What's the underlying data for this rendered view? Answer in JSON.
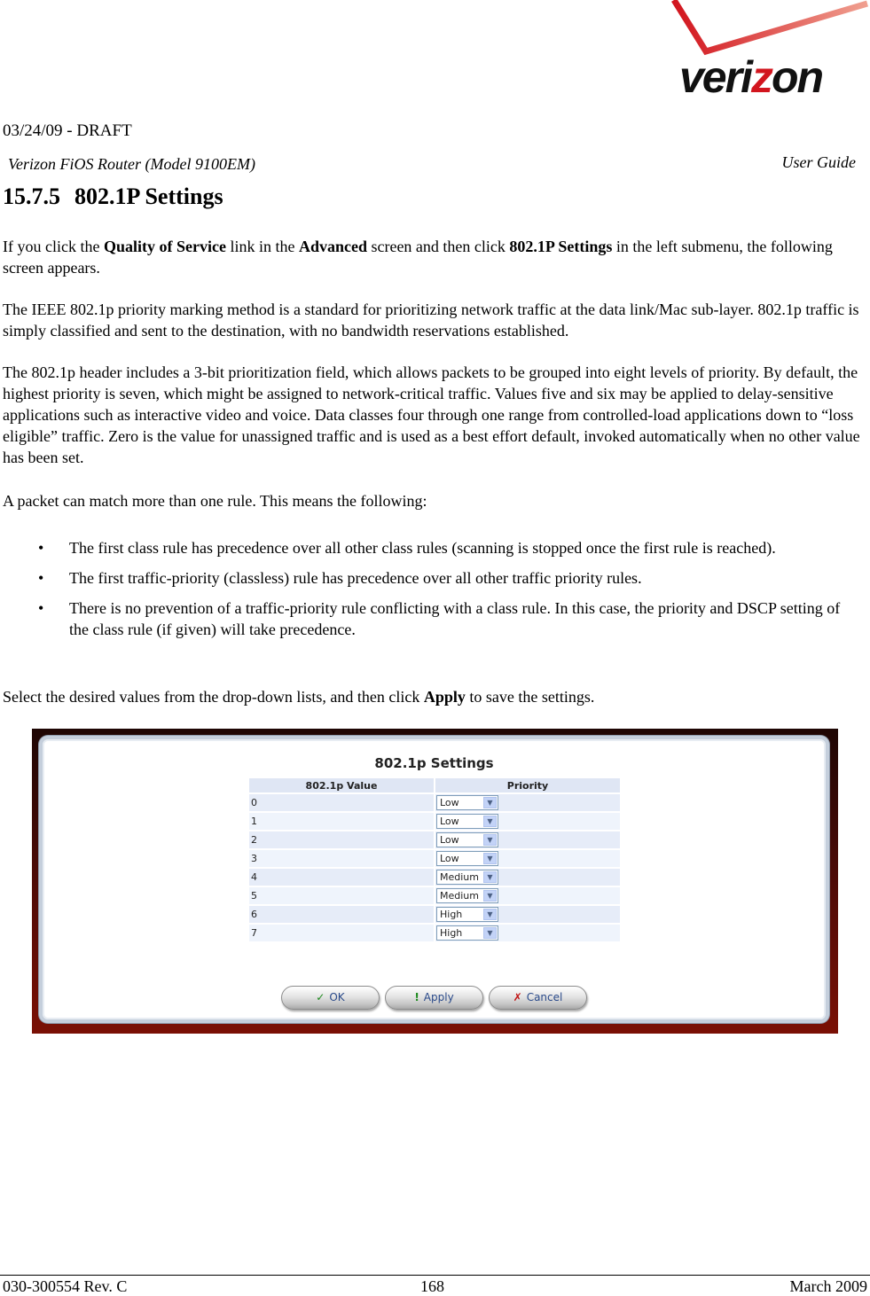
{
  "header": {
    "logo_text_pre": "veri",
    "logo_text_z": "z",
    "logo_text_post": "on",
    "draft": "03/24/09 - DRAFT",
    "model": "Verizon FiOS Router (Model 9100EM)",
    "guide": "User Guide"
  },
  "section": {
    "number": "15.7.5",
    "title": "802.1P Settings"
  },
  "body": {
    "p1": {
      "t1": "If you click the ",
      "b1": "Quality of Service",
      "t2": " link in the ",
      "b2": "Advanced",
      "t3": " screen and then click ",
      "b3": "802.1P Settings",
      "t4": " in the left submenu, the following screen appears."
    },
    "p2": "The IEEE 802.1p priority marking method is a standard for prioritizing network traffic at the data link/Mac sub-layer. 802.1p traffic is simply classified and sent to the destination, with no bandwidth reservations established.",
    "p3": "The 802.1p header includes a 3-bit prioritization field, which allows packets to be grouped into eight levels of priority. By default, the highest priority is seven, which might be assigned to network-critical traffic. Values five and six may be applied to delay-sensitive applications such as interactive video and voice. Data classes four through one range from controlled-load applications down to “loss eligible” traffic. Zero is the value for unassigned traffic and is used as a best effort default, invoked automatically when no other value has been set.",
    "p4": "A packet can match more than one rule. This means the following:",
    "bullets": [
      "The first class rule has precedence over all other class rules (scanning is stopped once the first rule is reached).",
      "The first traffic-priority (classless) rule has precedence over all other traffic priority rules.",
      "There is no prevention of a traffic-priority rule conflicting with a class rule. In this case, the priority and DSCP setting of the class rule (if given) will take precedence."
    ],
    "bullet_glyph": "•",
    "p5": {
      "t1": "Select the desired values from the drop-down lists, and then click ",
      "b1": "Apply",
      "t2": " to save the settings."
    }
  },
  "screenshot": {
    "title": "802.1p Settings",
    "columns": [
      "802.1p Value",
      "Priority"
    ],
    "rows": [
      {
        "value": "0",
        "priority": "Low"
      },
      {
        "value": "1",
        "priority": "Low"
      },
      {
        "value": "2",
        "priority": "Low"
      },
      {
        "value": "3",
        "priority": "Low"
      },
      {
        "value": "4",
        "priority": "Medium"
      },
      {
        "value": "5",
        "priority": "Medium"
      },
      {
        "value": "6",
        "priority": "High"
      },
      {
        "value": "7",
        "priority": "High"
      }
    ],
    "dropdown_arrow": "▼",
    "buttons": {
      "ok": {
        "icon": "✓",
        "label": "OK"
      },
      "apply": {
        "icon": "!",
        "label": "Apply"
      },
      "cancel": {
        "icon": "✗",
        "label": "Cancel"
      }
    }
  },
  "footer": {
    "doc_number": "030-300554 Rev. C",
    "page": "168",
    "date": "March 2009"
  },
  "colors": {
    "brand_red": "#d2151e",
    "frame_top": "#1e0604",
    "frame_bottom": "#7a1005",
    "table_header": "#dfe6f4",
    "button_text": "#2a4a8a"
  }
}
